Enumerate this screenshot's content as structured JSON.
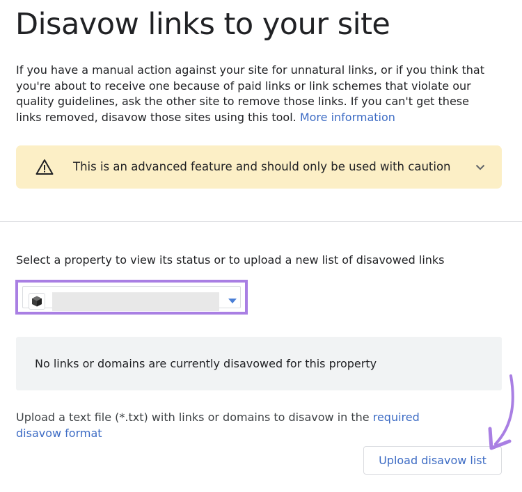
{
  "page": {
    "title": "Disavow links to your site",
    "intro_text": "If you have a manual action against your site for unnatural links, or if you think that you're about to receive one because of paid links or link schemes that violate our quality guidelines, ask the other site to remove those links. If you can't get these links removed, disavow those sites using this tool.",
    "intro_link": "More information"
  },
  "warning": {
    "icon": "warning-triangle-icon",
    "text": "This is an advanced feature and should only be used with caution",
    "expand_icon": "chevron-down-icon"
  },
  "property": {
    "label": "Select a property to view its status or to upload a new list of disavowed links",
    "selected_value": "",
    "icon": "property-cube-icon"
  },
  "status": {
    "text": "No links or domains are currently disavowed for this property"
  },
  "upload": {
    "description": "Upload a text file (*.txt) with links or domains to disavow in the",
    "format_link": "required disavow format",
    "button_label": "Upload disavow list"
  },
  "colors": {
    "link": "#3c6bc4",
    "warning_bg": "#fcefc6",
    "highlight": "#a97fe3",
    "status_bg": "#f1f3f4"
  }
}
